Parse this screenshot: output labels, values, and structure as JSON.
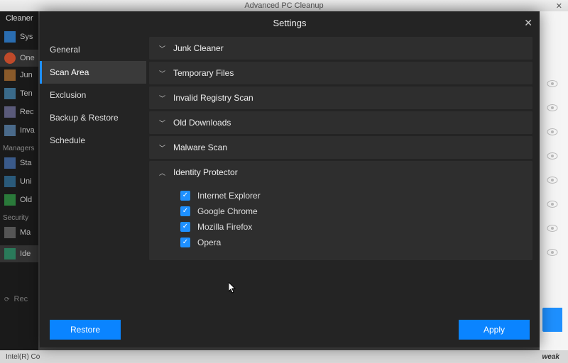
{
  "window_title": "Advanced PC Cleanup",
  "modal": {
    "title": "Settings",
    "sidebar": {
      "items": [
        {
          "label": "General"
        },
        {
          "label": "Scan Area",
          "active": true
        },
        {
          "label": "Exclusion"
        },
        {
          "label": "Backup & Restore"
        },
        {
          "label": "Schedule"
        }
      ]
    },
    "sections": [
      {
        "label": "Junk Cleaner",
        "expanded": false
      },
      {
        "label": "Temporary Files",
        "expanded": false
      },
      {
        "label": "Invalid Registry Scan",
        "expanded": false
      },
      {
        "label": "Old Downloads",
        "expanded": false
      },
      {
        "label": "Malware Scan",
        "expanded": false
      },
      {
        "label": "Identity Protector",
        "expanded": true,
        "items": [
          {
            "label": "Internet Explorer",
            "checked": true
          },
          {
            "label": "Google Chrome",
            "checked": true
          },
          {
            "label": "Mozilla Firefox",
            "checked": true
          },
          {
            "label": "Opera",
            "checked": true
          }
        ]
      }
    ],
    "buttons": {
      "restore": "Restore",
      "apply": "Apply"
    }
  },
  "background": {
    "cleaner_tab": "Cleaner",
    "left_items": [
      "Sys",
      "One",
      "Jun",
      "Ten",
      "Rec",
      "Inva"
    ],
    "managers_label": "Managers",
    "manager_items": [
      "Sta",
      "Uni",
      "Old"
    ],
    "security_label": "Security",
    "security_items": [
      "Ma",
      "Ide"
    ],
    "recent_label": "Rec",
    "status_left": "Intel(R) Co",
    "status_right": "weak"
  }
}
